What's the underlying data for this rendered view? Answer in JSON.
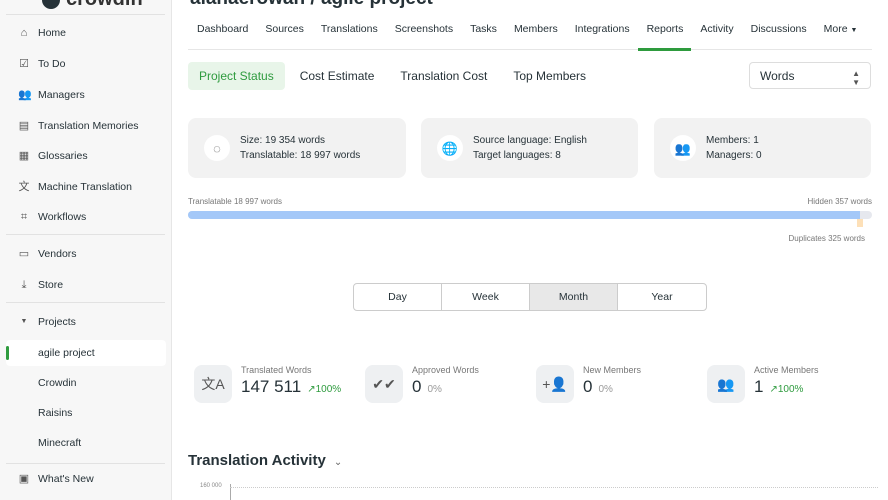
{
  "app": {
    "logo": "crowdin",
    "project_title": "alanaerowan / agile project"
  },
  "sidebar": {
    "items": [
      {
        "label": "Home",
        "icon": "home-icon"
      },
      {
        "label": "To Do",
        "icon": "checklist-icon"
      },
      {
        "label": "Managers",
        "icon": "people-icon"
      },
      {
        "label": "Translation Memories",
        "icon": "book-icon"
      },
      {
        "label": "Glossaries",
        "icon": "glossary-icon"
      },
      {
        "label": "Machine Translation",
        "icon": "translate-icon"
      },
      {
        "label": "Workflows",
        "icon": "workflow-icon"
      },
      {
        "label": "Vendors",
        "icon": "store-icon"
      },
      {
        "label": "Store",
        "icon": "download-icon"
      }
    ],
    "projects_label": "Projects",
    "projects": [
      "agile project",
      "Crowdin",
      "Raisins",
      "Minecraft"
    ],
    "whats_new": "What's New"
  },
  "tabs": [
    "Dashboard",
    "Sources",
    "Translations",
    "Screenshots",
    "Tasks",
    "Members",
    "Integrations",
    "Reports",
    "Activity",
    "Discussions",
    "More"
  ],
  "active_tab": "Reports",
  "subtabs": [
    "Project Status",
    "Cost Estimate",
    "Translation Cost",
    "Top Members"
  ],
  "unit_select": "Words",
  "cards": {
    "size": "Size: 19 354 words",
    "translatable": "Translatable: 18 997 words",
    "source": "Source language: English",
    "targets": "Target languages: 8",
    "members": "Members: 1",
    "managers": "Managers: 0"
  },
  "progress": {
    "translatable_label": "Translatable 18 997 words",
    "hidden_label": "Hidden 357 words",
    "duplicates_label": "Duplicates 325 words",
    "translatable_fraction": 0.982
  },
  "periods": [
    "Day",
    "Week",
    "Month",
    "Year"
  ],
  "active_period": "Month",
  "stats": [
    {
      "label": "Translated Words",
      "value": "147 511",
      "change": "↗100%",
      "icon": "translate-icon"
    },
    {
      "label": "Approved Words",
      "value": "0",
      "change": "0%",
      "icon": "double-check-icon"
    },
    {
      "label": "New Members",
      "value": "0",
      "change": "0%",
      "icon": "add-person-icon"
    },
    {
      "label": "Active Members",
      "value": "1",
      "change": "↗100%",
      "icon": "people-icon"
    }
  ],
  "activity": {
    "title": "Translation Activity",
    "y_tick": "160 000"
  },
  "colors": {
    "accent": "#2e9b3e",
    "bar": "#a4c8f8"
  }
}
